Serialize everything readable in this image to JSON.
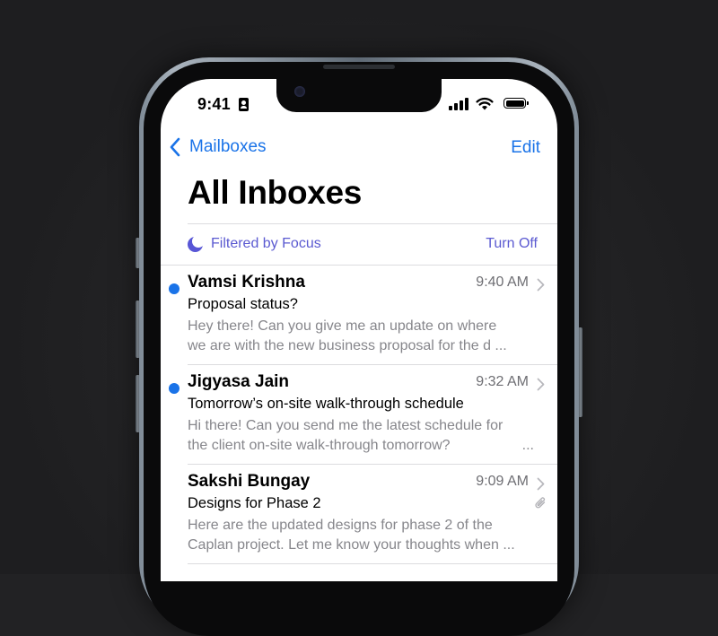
{
  "status_bar": {
    "time": "9:41"
  },
  "nav": {
    "back_label": "Mailboxes",
    "edit_label": "Edit"
  },
  "title": "All Inboxes",
  "focus_filter": {
    "label": "Filtered by Focus",
    "action": "Turn Off"
  },
  "colors": {
    "accent": "#1a73e8",
    "focus": "#5b5ad1",
    "unread": "#1a73e8"
  },
  "messages": [
    {
      "sender": "Vamsi Krishna",
      "time": "9:40 AM",
      "subject": "Proposal status?",
      "preview_line1": "Hey there! Can you give me an update on where",
      "preview_line2": "we are with the new business proposal for the d ...",
      "unread": true,
      "attachment": false
    },
    {
      "sender": "Jigyasa Jain",
      "time": "9:32 AM",
      "subject": "Tomorrow’s on-site walk-through schedule",
      "preview_line1": "Hi there! Can you send me the latest schedule for",
      "preview_line2": "the client on-site walk-through tomorrow?",
      "preview_ellipsis": "...",
      "unread": true,
      "attachment": false
    },
    {
      "sender": "Sakshi Bungay",
      "time": "9:09 AM",
      "subject": "Designs for Phase 2",
      "preview_line1": "Here are the updated designs for phase 2 of the",
      "preview_line2": "Caplan project. Let me know your thoughts when ...",
      "unread": false,
      "attachment": true
    }
  ]
}
